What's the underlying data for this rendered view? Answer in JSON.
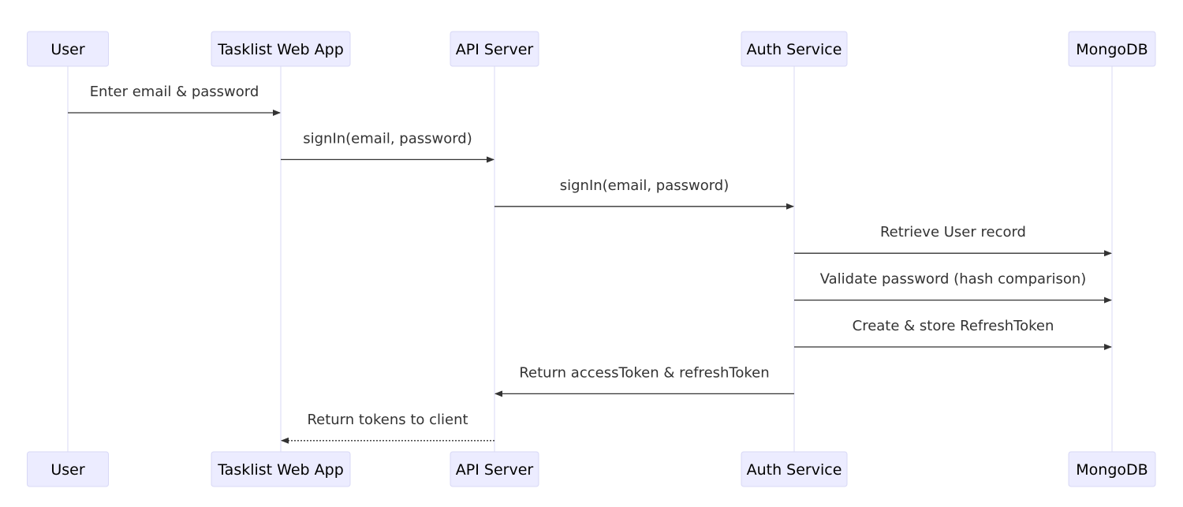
{
  "diagram": {
    "type": "sequence",
    "participants": [
      {
        "id": "user",
        "label": "User"
      },
      {
        "id": "webapp",
        "label": "Tasklist Web App"
      },
      {
        "id": "api",
        "label": "API Server"
      },
      {
        "id": "auth",
        "label": "Auth Service"
      },
      {
        "id": "mongo",
        "label": "MongoDB"
      }
    ],
    "messages": [
      {
        "from": "user",
        "to": "webapp",
        "label": "Enter email & password",
        "style": "solid"
      },
      {
        "from": "webapp",
        "to": "api",
        "label": "signIn(email, password)",
        "style": "solid"
      },
      {
        "from": "api",
        "to": "auth",
        "label": "signIn(email, password)",
        "style": "solid"
      },
      {
        "from": "auth",
        "to": "mongo",
        "label": "Retrieve User record",
        "style": "solid"
      },
      {
        "from": "auth",
        "to": "mongo",
        "label": "Validate password (hash comparison)",
        "style": "solid"
      },
      {
        "from": "auth",
        "to": "mongo",
        "label": "Create & store RefreshToken",
        "style": "solid"
      },
      {
        "from": "auth",
        "to": "api",
        "label": "Return accessToken & refreshToken",
        "style": "solid"
      },
      {
        "from": "api",
        "to": "webapp",
        "label": "Return tokens to client",
        "style": "dotted"
      }
    ],
    "colors": {
      "actor_fill": "#ECECFF",
      "actor_border": "#d8d8f6",
      "line": "#333333",
      "text": "#333333"
    }
  }
}
